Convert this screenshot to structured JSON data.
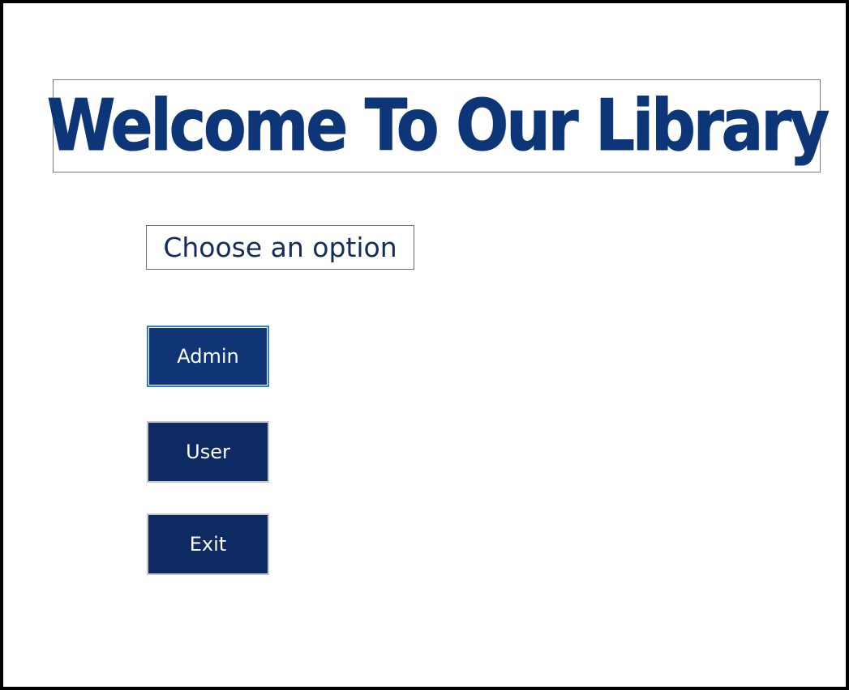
{
  "banner": {
    "title": "Welcome To Our Library"
  },
  "prompt": {
    "label": "Choose an option"
  },
  "buttons": {
    "admin_label": "Admin",
    "user_label": "User",
    "exit_label": "Exit"
  },
  "colors": {
    "title": "#0d3678",
    "button_bg": "#0e2a62",
    "button_focused_bg": "#0f3576",
    "button_focus_border": "#2f7fd0",
    "window_border": "#000000"
  }
}
